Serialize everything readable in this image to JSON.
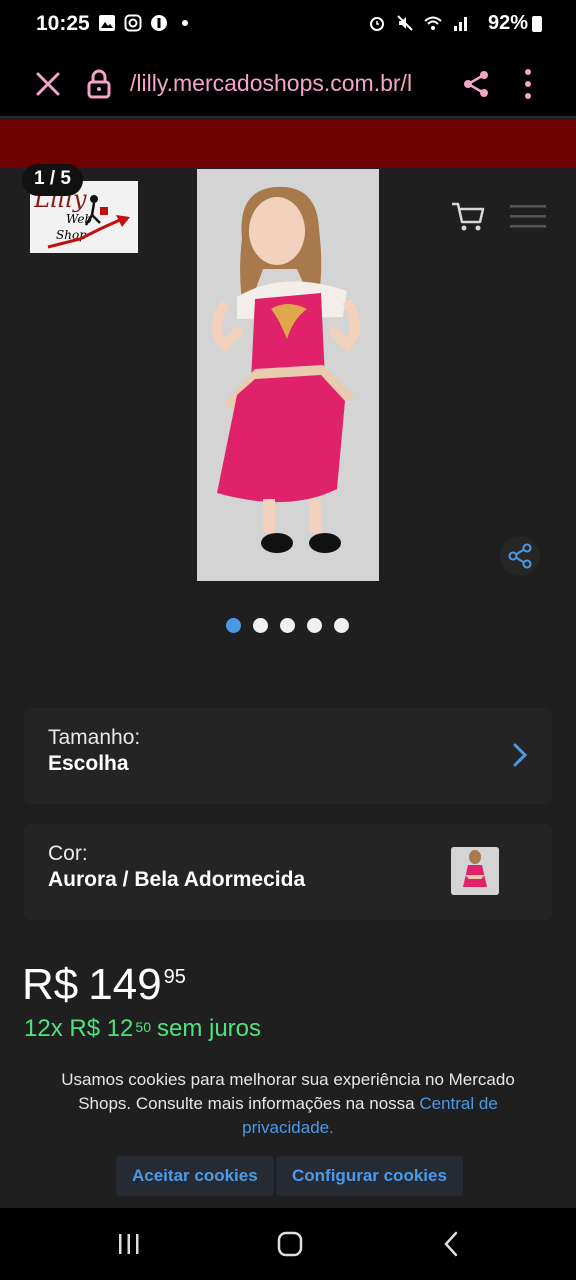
{
  "status_bar": {
    "time": "10:25",
    "battery": "92%"
  },
  "browser": {
    "url": "/lilly.mercadoshops.com.br/l"
  },
  "colors": {
    "banner": "#6e0000",
    "link": "#4a9ae8",
    "installments": "#4ee27d",
    "url_text": "#f4a4c6"
  },
  "header": {
    "page_counter": "1 / 5",
    "logo_text": "Lilly Web Shop"
  },
  "carousel": {
    "total": 5,
    "active_index": 0
  },
  "variations": {
    "size": {
      "label": "Tamanho:",
      "value": "Escolha"
    },
    "color": {
      "label": "Cor:",
      "value": "Aurora / Bela Adormecida"
    }
  },
  "price": {
    "currency": "R$",
    "integer": "149",
    "cents": "95"
  },
  "installments": {
    "prefix": "12x R$ 12",
    "cents": "50",
    "suffix": "sem juros"
  },
  "cookie": {
    "text": "Usamos cookies para melhorar sua experiência no Mercado Shops. Consulte mais informações na nossa",
    "link": "Central de privacidade.",
    "accept": "Aceitar cookies",
    "configure": "Configurar cookies"
  }
}
